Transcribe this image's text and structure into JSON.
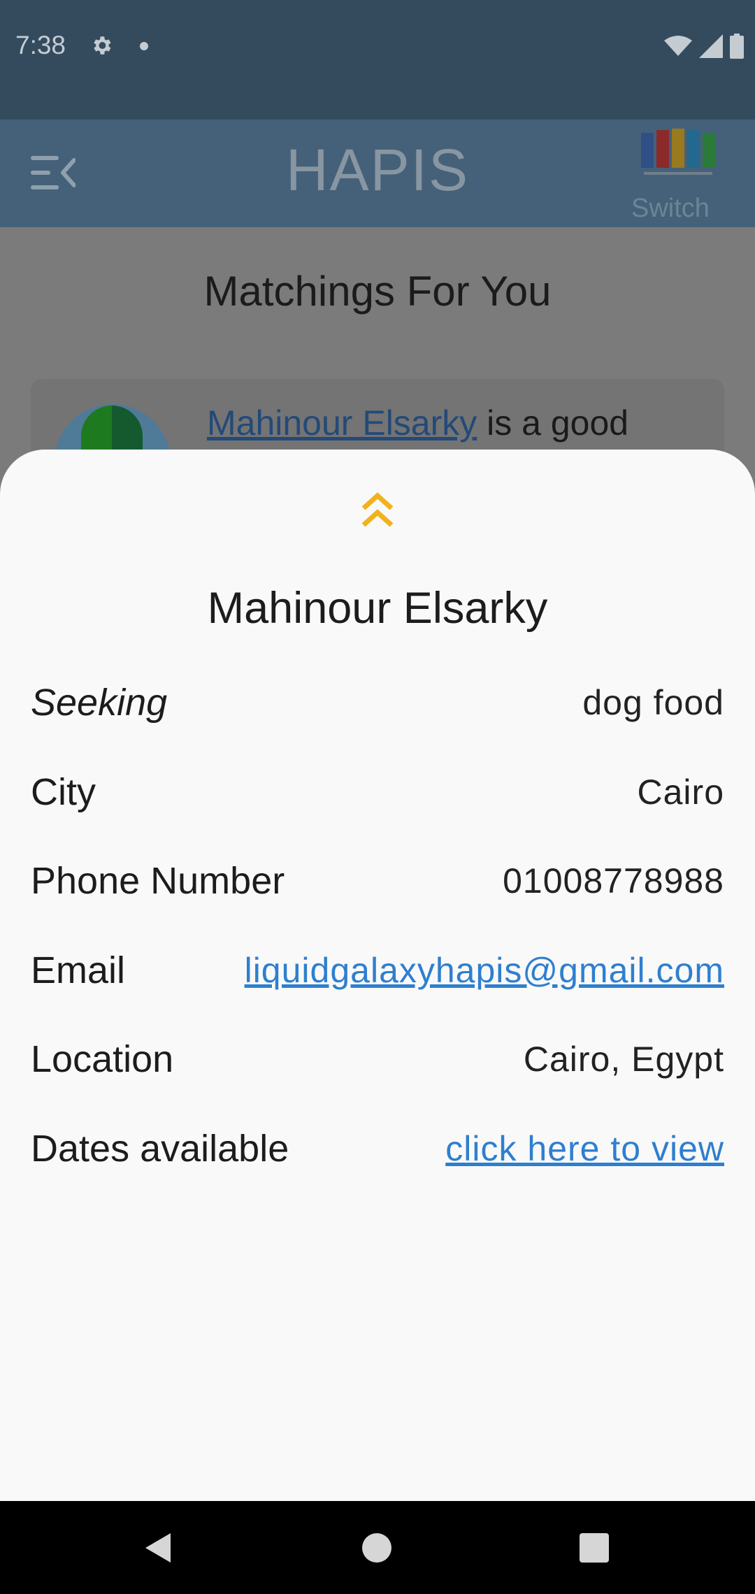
{
  "status_bar": {
    "time": "7:38"
  },
  "app_bar": {
    "title": "HAPIS",
    "switch_label": "Switch"
  },
  "page": {
    "heading": "Matchings For You",
    "match_card": {
      "name_link": "Mahinour Elsarky",
      "suffix": " is a good"
    }
  },
  "sheet": {
    "name": "Mahinour Elsarky",
    "rows": [
      {
        "label": "Seeking",
        "value": "dog food"
      },
      {
        "label": "City",
        "value": "Cairo"
      },
      {
        "label": "Phone Number",
        "value": "01008778988"
      },
      {
        "label": "Email",
        "value": "liquidgalaxyhapis@gmail.com"
      },
      {
        "label": "Location",
        "value": "Cairo, Egypt"
      },
      {
        "label": "Dates available",
        "value": "click here to view"
      }
    ]
  },
  "colors": {
    "app_bar": "#456179",
    "status_bar": "#344b5e",
    "link": "#2e7fcf",
    "collapse_icon": "#f2b21b",
    "sheet_background": "#f9f9f9"
  },
  "icons": {
    "menu": "menu-collapse-icon",
    "logo": "liquid-galaxy-logo",
    "collapse": "double-chevron-up-icon",
    "nav": [
      "back-icon",
      "home-icon",
      "recents-icon"
    ]
  }
}
